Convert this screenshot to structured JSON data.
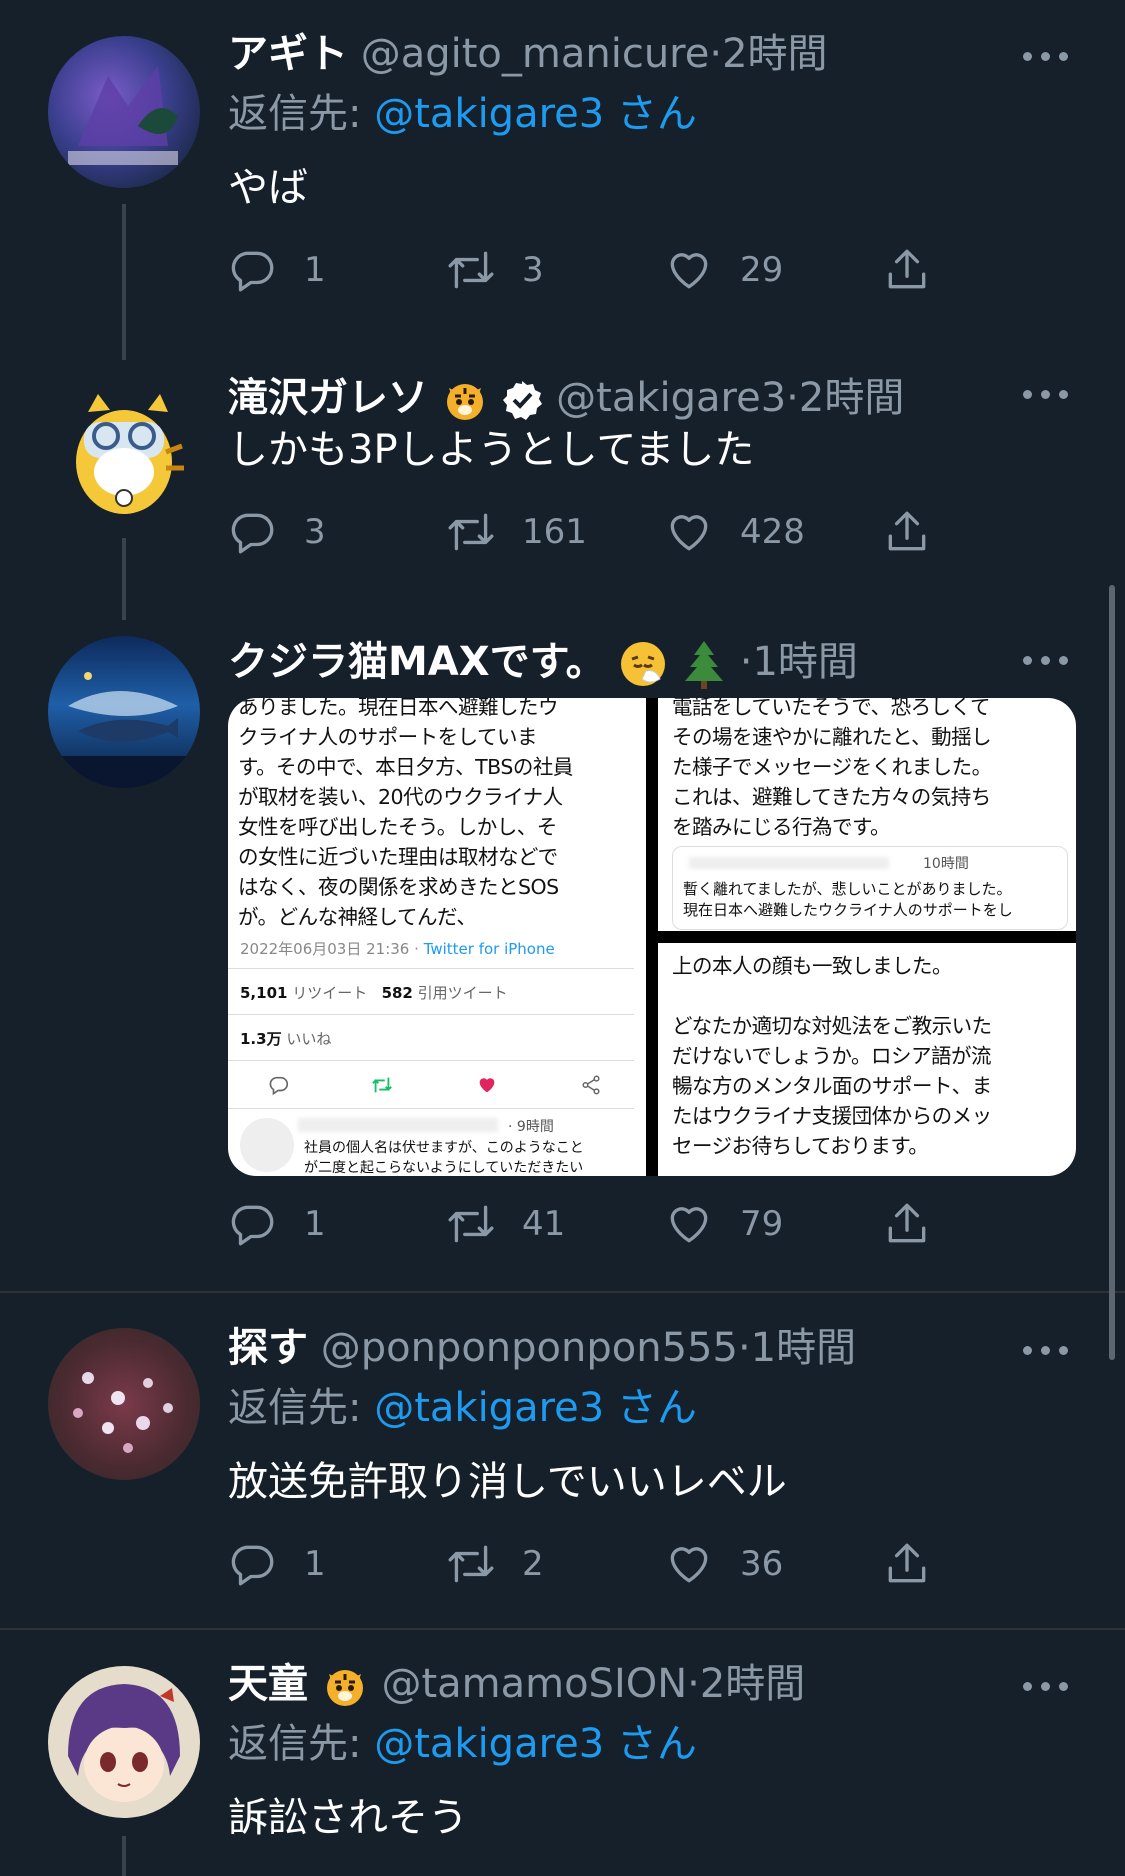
{
  "tweets": [
    {
      "name": "アギト",
      "handle": "@agito_manicure",
      "time": "2時間",
      "reply_label": "返信先:",
      "reply_mention": "@takigare3",
      "reply_suffix": "さん",
      "text": "やば",
      "replies": "1",
      "retweets": "3",
      "likes": "29"
    },
    {
      "name": "滝沢ガレソ",
      "handle": "@takigare3",
      "time": "2時間",
      "verified": true,
      "text": "しかも3Pしようとしてました",
      "replies": "3",
      "retweets": "161",
      "likes": "428"
    },
    {
      "name": "クジラ猫MAXです。",
      "time": "1時間",
      "replies": "1",
      "retweets": "41",
      "likes": "79",
      "media": {
        "left_lines": [
          "ありました。現在日本へ避難したウ",
          "クライナ人のサポートをしていま",
          "す。その中で、本日夕方、TBSの社員",
          "が取材を装い、20代のウクライナ人",
          "女性を呼び出したそう。しかし、そ",
          "の女性に近づいた理由は取材などで",
          "はなく、夜の関係を求めきたとSOS",
          "が。どんな神経してんだ、"
        ],
        "left_meta": "2022年06月03日 21:36 · ",
        "left_via": "Twitter for iPhone",
        "left_rt_count": "5,101",
        "left_rt_label": "リツイート",
        "left_quote_count": "582",
        "left_quote_label": "引用ツイート",
        "left_likes_count": "1.3万",
        "left_likes_label": "いいね",
        "left_reply_time": "9時間",
        "left_reply_lines": [
          "社員の個人名は伏せますが、このようなこと",
          "が二度と起こらないようにしていただきたい"
        ],
        "top_right_lines": [
          "電話をしていたそうで、恐ろしくて",
          "その場を速やかに離れたと、動揺し",
          "た様子でメッセージをくれました。",
          "これは、避難してきた方々の気持ち",
          "を踏みにじる行為です。"
        ],
        "top_right_quote_time": "10時間",
        "top_right_quote_lines": [
          "暫く離れてましたが、悲しいことがありました。",
          "現在日本へ避難したウクライナ人のサポートをし"
        ],
        "bottom_right_lines": [
          "上の本人の顔も一致しました。",
          "",
          "どなたか適切な対処法をご教示いた",
          "だけないでしょうか。ロシア語が流",
          "暢な方のメンタル面のサポート、ま",
          "たはウクライナ支援団体からのメッ",
          "セージお待ちしております。"
        ]
      }
    },
    {
      "name": "探す",
      "handle": "@ponponponpon555",
      "time": "1時間",
      "reply_label": "返信先:",
      "reply_mention": "@takigare3",
      "reply_suffix": "さん",
      "text": "放送免許取り消しでいいレベル",
      "replies": "1",
      "retweets": "2",
      "likes": "36"
    },
    {
      "name": "天童",
      "handle": "@tamamoSION",
      "time": "2時間",
      "reply_label": "返信先:",
      "reply_mention": "@takigare3",
      "reply_suffix": "さん",
      "text": "訴訟されそう"
    }
  ],
  "colors": {
    "background": "#15202b",
    "text": "#ffffff",
    "secondary": "#8b98a5",
    "link": "#1d9bf0"
  },
  "icons": [
    "reply-icon",
    "retweet-icon",
    "like-icon",
    "share-icon",
    "more-icon",
    "verified-icon"
  ]
}
